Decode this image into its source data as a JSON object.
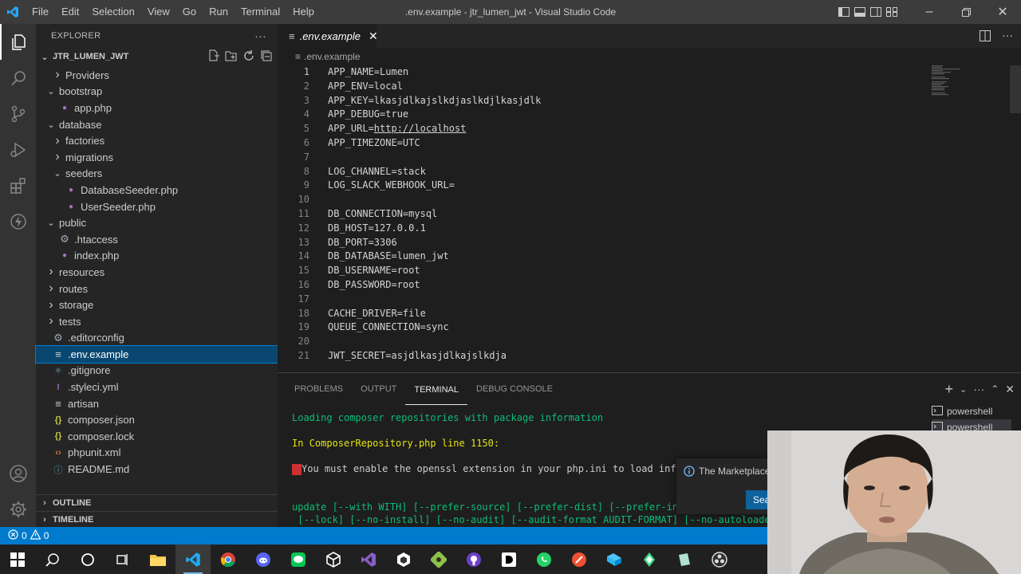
{
  "titlebar": {
    "menu": [
      "File",
      "Edit",
      "Selection",
      "View",
      "Go",
      "Run",
      "Terminal",
      "Help"
    ],
    "window_title": ".env.example - jtr_lumen_jwt - Visual Studio Code"
  },
  "sidebar": {
    "header": "EXPLORER",
    "more": "···",
    "folder_name": "JTR_LUMEN_JWT",
    "items": [
      {
        "label": "Providers",
        "kind": "folder",
        "open": false,
        "depth": 2,
        "icon": "chevron-right"
      },
      {
        "label": "bootstrap",
        "kind": "folder",
        "open": true,
        "depth": 1,
        "icon": "chevron-down"
      },
      {
        "label": "app.php",
        "kind": "php",
        "depth": 2,
        "icon": "php-file-icon"
      },
      {
        "label": "database",
        "kind": "folder",
        "open": true,
        "depth": 1,
        "icon": "chevron-down"
      },
      {
        "label": "factories",
        "kind": "folder",
        "open": false,
        "depth": 2,
        "icon": "chevron-right"
      },
      {
        "label": "migrations",
        "kind": "folder",
        "open": false,
        "depth": 2,
        "icon": "chevron-right"
      },
      {
        "label": "seeders",
        "kind": "folder",
        "open": true,
        "depth": 2,
        "icon": "chevron-down"
      },
      {
        "label": "DatabaseSeeder.php",
        "kind": "php",
        "depth": 3,
        "icon": "php-file-icon"
      },
      {
        "label": "UserSeeder.php",
        "kind": "php",
        "depth": 3,
        "icon": "php-file-icon"
      },
      {
        "label": "public",
        "kind": "folder",
        "open": true,
        "depth": 1,
        "icon": "chevron-down"
      },
      {
        "label": ".htaccess",
        "kind": "gear",
        "depth": 2,
        "icon": "gear-file-icon"
      },
      {
        "label": "index.php",
        "kind": "php",
        "depth": 2,
        "icon": "php-file-icon"
      },
      {
        "label": "resources",
        "kind": "folder",
        "open": false,
        "depth": 1,
        "icon": "chevron-right"
      },
      {
        "label": "routes",
        "kind": "folder",
        "open": false,
        "depth": 1,
        "icon": "chevron-right"
      },
      {
        "label": "storage",
        "kind": "folder",
        "open": false,
        "depth": 1,
        "icon": "chevron-right"
      },
      {
        "label": "tests",
        "kind": "folder",
        "open": false,
        "depth": 1,
        "icon": "chevron-right"
      },
      {
        "label": ".editorconfig",
        "kind": "gear",
        "depth": 1,
        "icon": "gear-file-icon"
      },
      {
        "label": ".env.example",
        "kind": "env",
        "depth": 1,
        "icon": "lines-file-icon",
        "selected": true
      },
      {
        "label": ".gitignore",
        "kind": "git",
        "depth": 1,
        "icon": "git-file-icon"
      },
      {
        "label": ".styleci.yml",
        "kind": "yml",
        "depth": 1,
        "icon": "yml-file-icon"
      },
      {
        "label": "artisan",
        "kind": "env",
        "depth": 1,
        "icon": "lines-file-icon"
      },
      {
        "label": "composer.json",
        "kind": "json",
        "depth": 1,
        "icon": "json-file-icon"
      },
      {
        "label": "composer.lock",
        "kind": "json",
        "depth": 1,
        "icon": "json-file-icon"
      },
      {
        "label": "phpunit.xml",
        "kind": "xml",
        "depth": 1,
        "icon": "xml-file-icon"
      },
      {
        "label": "README.md",
        "kind": "md",
        "depth": 1,
        "icon": "info-file-icon"
      }
    ],
    "outline": "OUTLINE",
    "timeline": "TIMELINE"
  },
  "editor": {
    "tab_label": ".env.example",
    "breadcrumb": ".env.example",
    "lines": [
      "APP_NAME=Lumen",
      "APP_ENV=local",
      "APP_KEY=lkasjdlkajslkdjaslkdjlkasjdlk",
      "APP_DEBUG=true",
      "APP_URL=http://localhost",
      "APP_TIMEZONE=UTC",
      "",
      "LOG_CHANNEL=stack",
      "LOG_SLACK_WEBHOOK_URL=",
      "",
      "DB_CONNECTION=mysql",
      "DB_HOST=127.0.0.1",
      "DB_PORT=3306",
      "DB_DATABASE=lumen_jwt",
      "DB_USERNAME=root",
      "DB_PASSWORD=root",
      "",
      "CACHE_DRIVER=file",
      "QUEUE_CONNECTION=sync",
      "",
      "JWT_SECRET=asjdlkasjdlkajslkdja"
    ],
    "line_numbers": [
      "1",
      "2",
      "3",
      "4",
      "5",
      "6",
      "7",
      "8",
      "9",
      "10",
      "11",
      "12",
      "13",
      "14",
      "15",
      "16",
      "17",
      "18",
      "19",
      "20",
      "21"
    ],
    "url_line": {
      "prefix": "APP_URL=",
      "url": "http://localhost"
    }
  },
  "panel": {
    "tabs": [
      "PROBLEMS",
      "OUTPUT",
      "TERMINAL",
      "DEBUG CONSOLE"
    ],
    "active_tab": "TERMINAL",
    "terminal_lines": {
      "l1": "Loading composer repositories with package information",
      "l2": "In ComposerRepository.php line 1150:",
      "l3": "You must enable the openssl extension in your php.ini to load informatio",
      "l4": "update [--with WITH] [--prefer-source] [--prefer-dist] [--prefer-install P",
      "l5": " [--lock] [--no-install] [--no-audit] [--audit-format AUDIT-FORMAT] [--no-autoloader] [--no"
    },
    "terminals": [
      "powershell",
      "powershell"
    ]
  },
  "notification": {
    "text": "The Marketplace",
    "button": "Sea"
  },
  "statusbar": {
    "errors": "0",
    "warnings": "0"
  },
  "colors": {
    "accent": "#007acc",
    "selected": "#094771",
    "php": "#a074c4",
    "json": "#cbcb41",
    "xml": "#e37933",
    "terminal_green": "#0dbc79",
    "terminal_yellow": "#e5e510",
    "terminal_error": "#cd3131"
  },
  "taskbar": {
    "icons": [
      "windows-start-icon",
      "search-icon",
      "cortana-icon",
      "task-view-icon",
      "file-explorer-icon",
      "vscode-icon",
      "chrome-icon",
      "discord-icon",
      "line-icon",
      "unity-icon",
      "visual-studio-icon",
      "package-icon",
      "git-icon",
      "github-icon",
      "dev-icon",
      "whatsapp-icon",
      "git-scm-icon",
      "snip-icon",
      "android-icon",
      "app-icon",
      "obs-icon"
    ]
  }
}
